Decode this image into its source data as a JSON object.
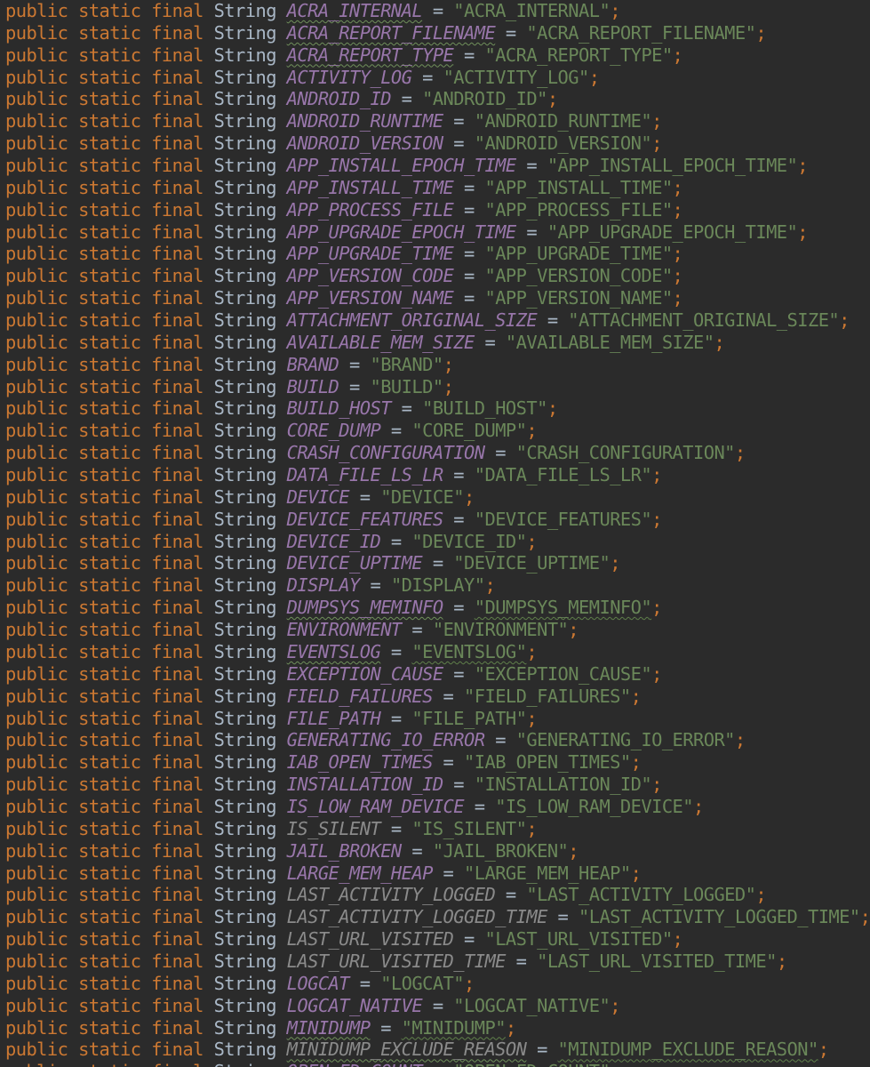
{
  "editor": {
    "keywords": [
      "public",
      "static",
      "final"
    ],
    "type_name": "String",
    "colors": {
      "background": "#2b2b2b",
      "keyword": "#cc7832",
      "type": "#a9b7c6",
      "constant": "#9876aa",
      "unused_constant": "#8a8a8a",
      "string": "#6a8759",
      "typo_underline": "#5f7f4a"
    },
    "lines": [
      {
        "name": "ACRA_INTERNAL",
        "value": "\"ACRA_INTERNAL\"",
        "name_typo": true,
        "value_typo": false,
        "unused": false
      },
      {
        "name": "ACRA_REPORT_FILENAME",
        "value": "\"ACRA_REPORT_FILENAME\"",
        "name_typo": true,
        "value_typo": false,
        "unused": false
      },
      {
        "name": "ACRA_REPORT_TYPE",
        "value": "\"ACRA_REPORT_TYPE\"",
        "name_typo": true,
        "value_typo": false,
        "unused": false
      },
      {
        "name": "ACTIVITY_LOG",
        "value": "\"ACTIVITY_LOG\"",
        "name_typo": false,
        "value_typo": false,
        "unused": false
      },
      {
        "name": "ANDROID_ID",
        "value": "\"ANDROID_ID\"",
        "name_typo": false,
        "value_typo": false,
        "unused": false
      },
      {
        "name": "ANDROID_RUNTIME",
        "value": "\"ANDROID_RUNTIME\"",
        "name_typo": false,
        "value_typo": false,
        "unused": false
      },
      {
        "name": "ANDROID_VERSION",
        "value": "\"ANDROID_VERSION\"",
        "name_typo": false,
        "value_typo": false,
        "unused": false
      },
      {
        "name": "APP_INSTALL_EPOCH_TIME",
        "value": "\"APP_INSTALL_EPOCH_TIME\"",
        "name_typo": false,
        "value_typo": false,
        "unused": false
      },
      {
        "name": "APP_INSTALL_TIME",
        "value": "\"APP_INSTALL_TIME\"",
        "name_typo": false,
        "value_typo": false,
        "unused": false
      },
      {
        "name": "APP_PROCESS_FILE",
        "value": "\"APP_PROCESS_FILE\"",
        "name_typo": false,
        "value_typo": false,
        "unused": false
      },
      {
        "name": "APP_UPGRADE_EPOCH_TIME",
        "value": "\"APP_UPGRADE_EPOCH_TIME\"",
        "name_typo": false,
        "value_typo": false,
        "unused": false
      },
      {
        "name": "APP_UPGRADE_TIME",
        "value": "\"APP_UPGRADE_TIME\"",
        "name_typo": false,
        "value_typo": false,
        "unused": false
      },
      {
        "name": "APP_VERSION_CODE",
        "value": "\"APP_VERSION_CODE\"",
        "name_typo": false,
        "value_typo": false,
        "unused": false
      },
      {
        "name": "APP_VERSION_NAME",
        "value": "\"APP_VERSION_NAME\"",
        "name_typo": false,
        "value_typo": false,
        "unused": false
      },
      {
        "name": "ATTACHMENT_ORIGINAL_SIZE",
        "value": "\"ATTACHMENT_ORIGINAL_SIZE\"",
        "name_typo": false,
        "value_typo": false,
        "unused": false
      },
      {
        "name": "AVAILABLE_MEM_SIZE",
        "value": "\"AVAILABLE_MEM_SIZE\"",
        "name_typo": false,
        "value_typo": false,
        "unused": false
      },
      {
        "name": "BRAND",
        "value": "\"BRAND\"",
        "name_typo": false,
        "value_typo": false,
        "unused": false
      },
      {
        "name": "BUILD",
        "value": "\"BUILD\"",
        "name_typo": false,
        "value_typo": false,
        "unused": false
      },
      {
        "name": "BUILD_HOST",
        "value": "\"BUILD_HOST\"",
        "name_typo": false,
        "value_typo": false,
        "unused": false
      },
      {
        "name": "CORE_DUMP",
        "value": "\"CORE_DUMP\"",
        "name_typo": false,
        "value_typo": false,
        "unused": false
      },
      {
        "name": "CRASH_CONFIGURATION",
        "value": "\"CRASH_CONFIGURATION\"",
        "name_typo": false,
        "value_typo": false,
        "unused": false
      },
      {
        "name": "DATA_FILE_LS_LR",
        "value": "\"DATA_FILE_LS_LR\"",
        "name_typo": false,
        "value_typo": false,
        "unused": false
      },
      {
        "name": "DEVICE",
        "value": "\"DEVICE\"",
        "name_typo": false,
        "value_typo": false,
        "unused": false
      },
      {
        "name": "DEVICE_FEATURES",
        "value": "\"DEVICE_FEATURES\"",
        "name_typo": false,
        "value_typo": false,
        "unused": false
      },
      {
        "name": "DEVICE_ID",
        "value": "\"DEVICE_ID\"",
        "name_typo": false,
        "value_typo": false,
        "unused": false
      },
      {
        "name": "DEVICE_UPTIME",
        "value": "\"DEVICE_UPTIME\"",
        "name_typo": false,
        "value_typo": false,
        "unused": false
      },
      {
        "name": "DISPLAY",
        "value": "\"DISPLAY\"",
        "name_typo": false,
        "value_typo": false,
        "unused": false
      },
      {
        "name": "DUMPSYS_MEMINFO",
        "value": "\"DUMPSYS_MEMINFO\"",
        "name_typo": true,
        "value_typo": true,
        "unused": false
      },
      {
        "name": "ENVIRONMENT",
        "value": "\"ENVIRONMENT\"",
        "name_typo": false,
        "value_typo": false,
        "unused": false
      },
      {
        "name": "EVENTSLOG",
        "value": "\"EVENTSLOG\"",
        "name_typo": true,
        "value_typo": true,
        "unused": false
      },
      {
        "name": "EXCEPTION_CAUSE",
        "value": "\"EXCEPTION_CAUSE\"",
        "name_typo": false,
        "value_typo": false,
        "unused": false
      },
      {
        "name": "FIELD_FAILURES",
        "value": "\"FIELD_FAILURES\"",
        "name_typo": false,
        "value_typo": false,
        "unused": false
      },
      {
        "name": "FILE_PATH",
        "value": "\"FILE_PATH\"",
        "name_typo": false,
        "value_typo": false,
        "unused": false
      },
      {
        "name": "GENERATING_IO_ERROR",
        "value": "\"GENERATING_IO_ERROR\"",
        "name_typo": false,
        "value_typo": false,
        "unused": false
      },
      {
        "name": "IAB_OPEN_TIMES",
        "value": "\"IAB_OPEN_TIMES\"",
        "name_typo": false,
        "value_typo": false,
        "unused": false
      },
      {
        "name": "INSTALLATION_ID",
        "value": "\"INSTALLATION_ID\"",
        "name_typo": false,
        "value_typo": false,
        "unused": false
      },
      {
        "name": "IS_LOW_RAM_DEVICE",
        "value": "\"IS_LOW_RAM_DEVICE\"",
        "name_typo": false,
        "value_typo": false,
        "unused": false
      },
      {
        "name": "IS_SILENT",
        "value": "\"IS_SILENT\"",
        "name_typo": false,
        "value_typo": false,
        "unused": true
      },
      {
        "name": "JAIL_BROKEN",
        "value": "\"JAIL_BROKEN\"",
        "name_typo": false,
        "value_typo": false,
        "unused": false
      },
      {
        "name": "LARGE_MEM_HEAP",
        "value": "\"LARGE_MEM_HEAP\"",
        "name_typo": false,
        "value_typo": false,
        "unused": false
      },
      {
        "name": "LAST_ACTIVITY_LOGGED",
        "value": "\"LAST_ACTIVITY_LOGGED\"",
        "name_typo": false,
        "value_typo": false,
        "unused": true
      },
      {
        "name": "LAST_ACTIVITY_LOGGED_TIME",
        "value": "\"LAST_ACTIVITY_LOGGED_TIME\"",
        "name_typo": false,
        "value_typo": false,
        "unused": true
      },
      {
        "name": "LAST_URL_VISITED",
        "value": "\"LAST_URL_VISITED\"",
        "name_typo": false,
        "value_typo": false,
        "unused": true
      },
      {
        "name": "LAST_URL_VISITED_TIME",
        "value": "\"LAST_URL_VISITED_TIME\"",
        "name_typo": false,
        "value_typo": false,
        "unused": true
      },
      {
        "name": "LOGCAT",
        "value": "\"LOGCAT\"",
        "name_typo": false,
        "value_typo": false,
        "unused": false
      },
      {
        "name": "LOGCAT_NATIVE",
        "value": "\"LOGCAT_NATIVE\"",
        "name_typo": false,
        "value_typo": false,
        "unused": false
      },
      {
        "name": "MINIDUMP",
        "value": "\"MINIDUMP\"",
        "name_typo": true,
        "value_typo": true,
        "unused": false
      },
      {
        "name": "MINIDUMP_EXCLUDE_REASON",
        "value": "\"MINIDUMP_EXCLUDE_REASON\"",
        "name_typo": true,
        "value_typo": true,
        "unused": true
      },
      {
        "name": "OPEN_FD_COUNT",
        "value": "\"OPEN_FD_COUNT\"",
        "name_typo": false,
        "value_typo": false,
        "unused": false
      }
    ]
  }
}
